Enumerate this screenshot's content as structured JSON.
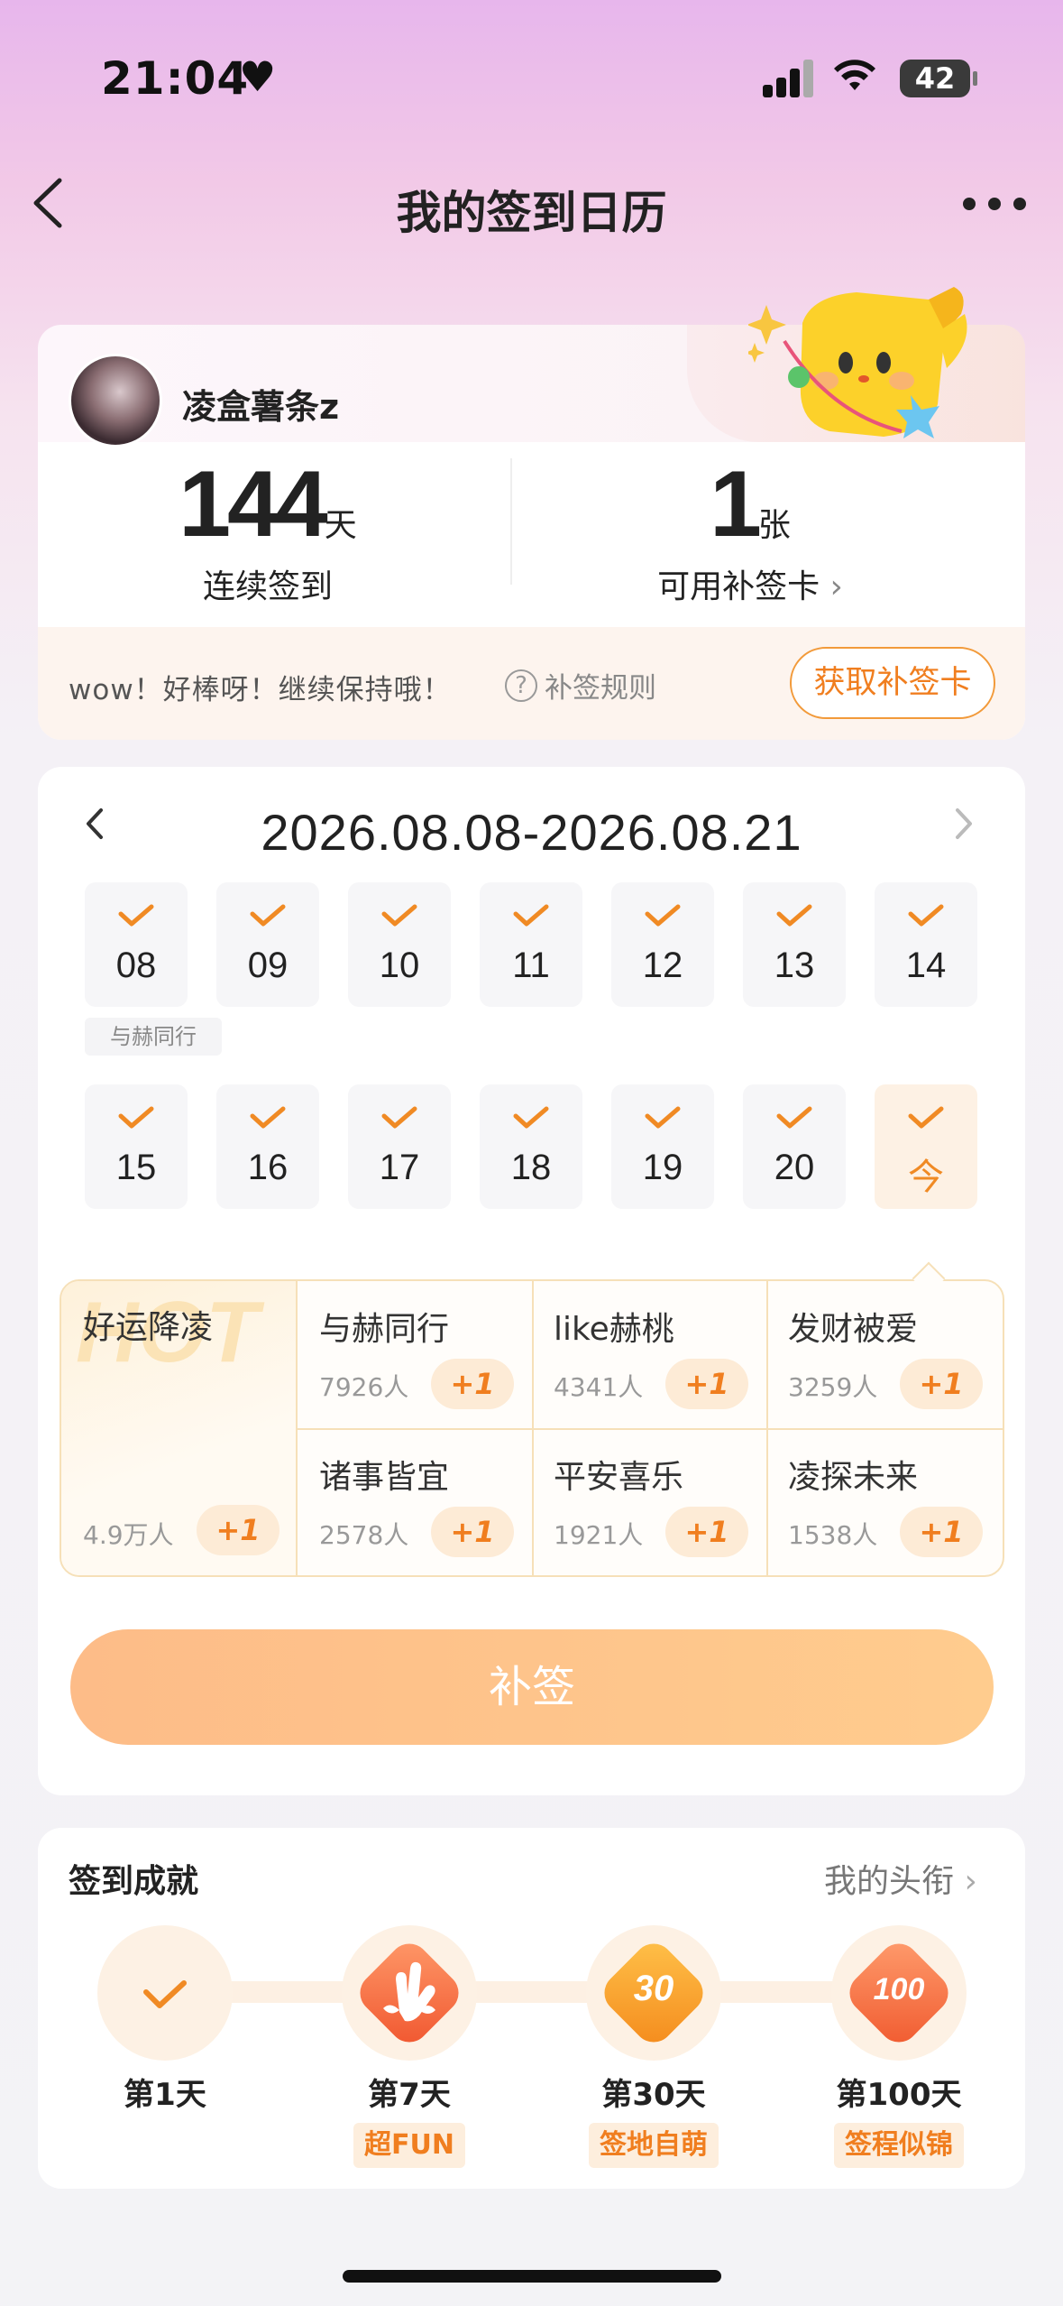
{
  "status_bar": {
    "time": "21:04",
    "battery": "42"
  },
  "nav": {
    "title": "我的签到日历"
  },
  "profile": {
    "username": "凌盒薯条z",
    "streak_value": "144",
    "streak_unit": "天",
    "streak_label": "连续签到",
    "cards_value": "1",
    "cards_unit": "张",
    "cards_label": "可用补签卡",
    "notice": "wow！好棒呀！继续保持哦！",
    "rules_label": "补签规则",
    "get_card_label": "获取补签卡"
  },
  "calendar": {
    "range": "2026.08.08-2026.08.21",
    "week1": [
      {
        "day": "08",
        "checked": true
      },
      {
        "day": "09",
        "checked": true
      },
      {
        "day": "10",
        "checked": true
      },
      {
        "day": "11",
        "checked": true
      },
      {
        "day": "12",
        "checked": true
      },
      {
        "day": "13",
        "checked": true
      },
      {
        "day": "14",
        "checked": true
      }
    ],
    "week2": [
      {
        "day": "15",
        "checked": true
      },
      {
        "day": "16",
        "checked": true
      },
      {
        "day": "17",
        "checked": true
      },
      {
        "day": "18",
        "checked": true
      },
      {
        "day": "19",
        "checked": true
      },
      {
        "day": "20",
        "checked": true
      },
      {
        "day": "今",
        "checked": true
      }
    ],
    "day_tag": "与赫同行"
  },
  "tags": {
    "hot": {
      "watermark": "HOT",
      "name": "好运降凌",
      "count": "4.9万人",
      "plus": "+1"
    },
    "items": [
      {
        "name": "与赫同行",
        "count": "7926人",
        "plus": "+1"
      },
      {
        "name": "like赫桃",
        "count": "4341人",
        "plus": "+1"
      },
      {
        "name": "发财被爱",
        "count": "3259人",
        "plus": "+1"
      },
      {
        "name": "诸事皆宜",
        "count": "2578人",
        "plus": "+1"
      },
      {
        "name": "平安喜乐",
        "count": "1921人",
        "plus": "+1"
      },
      {
        "name": "凌探未来",
        "count": "1538人",
        "plus": "+1"
      }
    ]
  },
  "resign_button": "补签",
  "achievements": {
    "title": "签到成就",
    "link": "我的头衔",
    "items": [
      {
        "day": "第1天",
        "badge": "",
        "art": ""
      },
      {
        "day": "第7天",
        "badge": "超FUN",
        "art": ""
      },
      {
        "day": "第30天",
        "badge": "签地自萌",
        "art": "30"
      },
      {
        "day": "第100天",
        "badge": "签程似锦",
        "art": "100"
      }
    ]
  },
  "colors": {
    "accent": "#f08a24",
    "tag_border": "#f6e0b8"
  }
}
